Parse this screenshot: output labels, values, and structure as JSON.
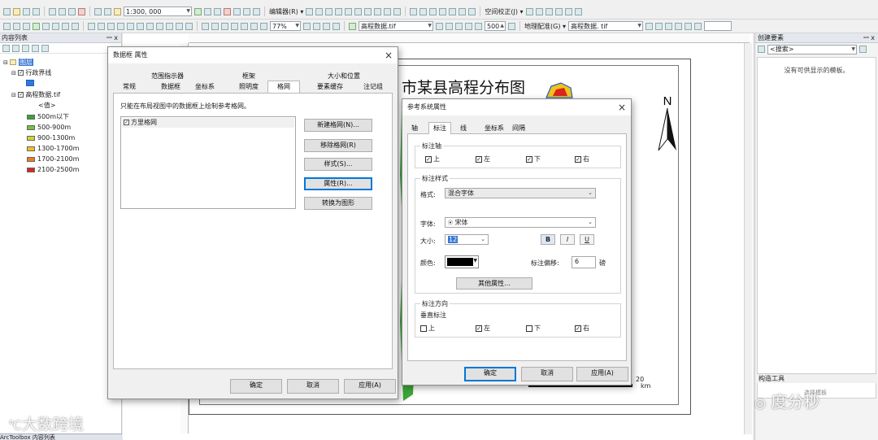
{
  "toolbar1": {
    "scale": "1:300, 000",
    "editor": "编辑器(R) ▾",
    "spatial_adjust": "空间校正(J) ▾"
  },
  "toolbar2": {
    "zoom": "77%",
    "layer": "高程数据.tif",
    "zoom_value": "500",
    "georef": "地理配准(G) ▾",
    "georef_layer": "高程数据. tif"
  },
  "toc": {
    "title": "内容列表",
    "pin": "ꟷ x",
    "layers_root": "图层",
    "layer1": "行政界线",
    "layer2": "高程数据.tif",
    "value_label": "<值>",
    "legend": [
      {
        "label": "500m以下",
        "color": "#3aa13a"
      },
      {
        "label": "500-900m",
        "color": "#74c043"
      },
      {
        "label": "900-1300m",
        "color": "#c8d92e"
      },
      {
        "label": "1300-1700m",
        "color": "#f1c21b"
      },
      {
        "label": "1700-2100m",
        "color": "#ef7d1f"
      },
      {
        "label": "2100-2500m",
        "color": "#d9251d"
      }
    ],
    "bottom_tabs": "ArcToolbox  内容列表"
  },
  "map": {
    "title": "市某县高程分布图",
    "north": "N",
    "scale_value": "20",
    "scale_unit": "km"
  },
  "right_panel": {
    "title": "创建要素",
    "pin": "ꟷ x",
    "search": "<搜索>",
    "empty": "没有可供显示的模板。",
    "construct": "构造工具",
    "construct_hint": "选择模板"
  },
  "frame_dialog": {
    "title": "数据框 属性",
    "tabs_row1": [
      "范围指示器",
      "框架",
      "大小和位置"
    ],
    "tabs_row2": [
      "常规",
      "数据框",
      "坐标系",
      "照明度",
      "格网",
      "要素缓存",
      "注记组"
    ],
    "hint": "只能在布局视图中的数据框上绘制参考格网。",
    "grid_item": "方里格网",
    "btn_new": "新建格网(N)...",
    "btn_remove": "移除格网(R)",
    "btn_style": "样式(S)...",
    "btn_props": "属性(R)...",
    "btn_convert": "转换为图形",
    "ok": "确定",
    "cancel": "取消",
    "apply": "应用(A)"
  },
  "ref_dialog": {
    "title": "参考系统属性",
    "tabs": [
      "轴",
      "标注",
      "线",
      "坐标系",
      "间隔"
    ],
    "axis_group": "标注轴",
    "axis_top": "上",
    "axis_left": "左",
    "axis_bottom": "下",
    "axis_right": "右",
    "style_group": "标注样式",
    "format_label": "格式:",
    "format_value": "混合字体",
    "font_label": "字体:",
    "font_value": "宋体",
    "size_label": "大小:",
    "size_value": "12",
    "bold": "B",
    "italic": "I",
    "underline": "U",
    "color_label": "颜色:",
    "offset_label": "标注偏移:",
    "offset_value": "6",
    "offset_unit": "磅",
    "more_btn": "其他属性...",
    "dir_group": "标注方向",
    "vertical": "垂直标注",
    "v_top": "上",
    "v_left": "左",
    "v_bottom": "下",
    "v_right": "右",
    "ok": "确定",
    "cancel": "取消",
    "apply": "应用(A)"
  },
  "watermarks": {
    "left": "大数跨境",
    "right": "度分秒"
  }
}
